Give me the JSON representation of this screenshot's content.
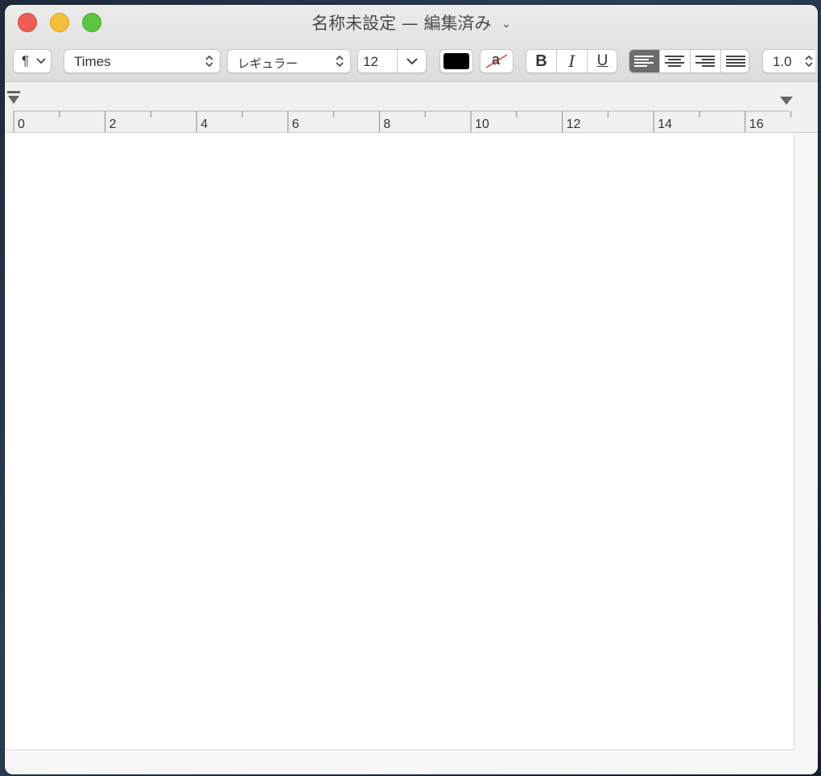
{
  "window": {
    "title": "名称未設定 — 編集済み",
    "title_chevron": "⌄"
  },
  "toolbar": {
    "paragraph_style": "¶",
    "font_family": "Times",
    "font_style": "レギュラー",
    "font_size": "12",
    "text_color": "#000000",
    "highlight_glyph": "a",
    "bold_label": "B",
    "italic_label": "I",
    "underline_label": "U",
    "alignment_selected": "left",
    "line_spacing": "1.0"
  },
  "ruler": {
    "labels": [
      "0",
      "2",
      "4",
      "6",
      "8",
      "10",
      "12",
      "14",
      "16"
    ]
  },
  "colors": {
    "close": "#ee5d56",
    "minimize": "#f6be3b",
    "zoom": "#5ec544",
    "selected_segment": "#6b6b6b"
  }
}
